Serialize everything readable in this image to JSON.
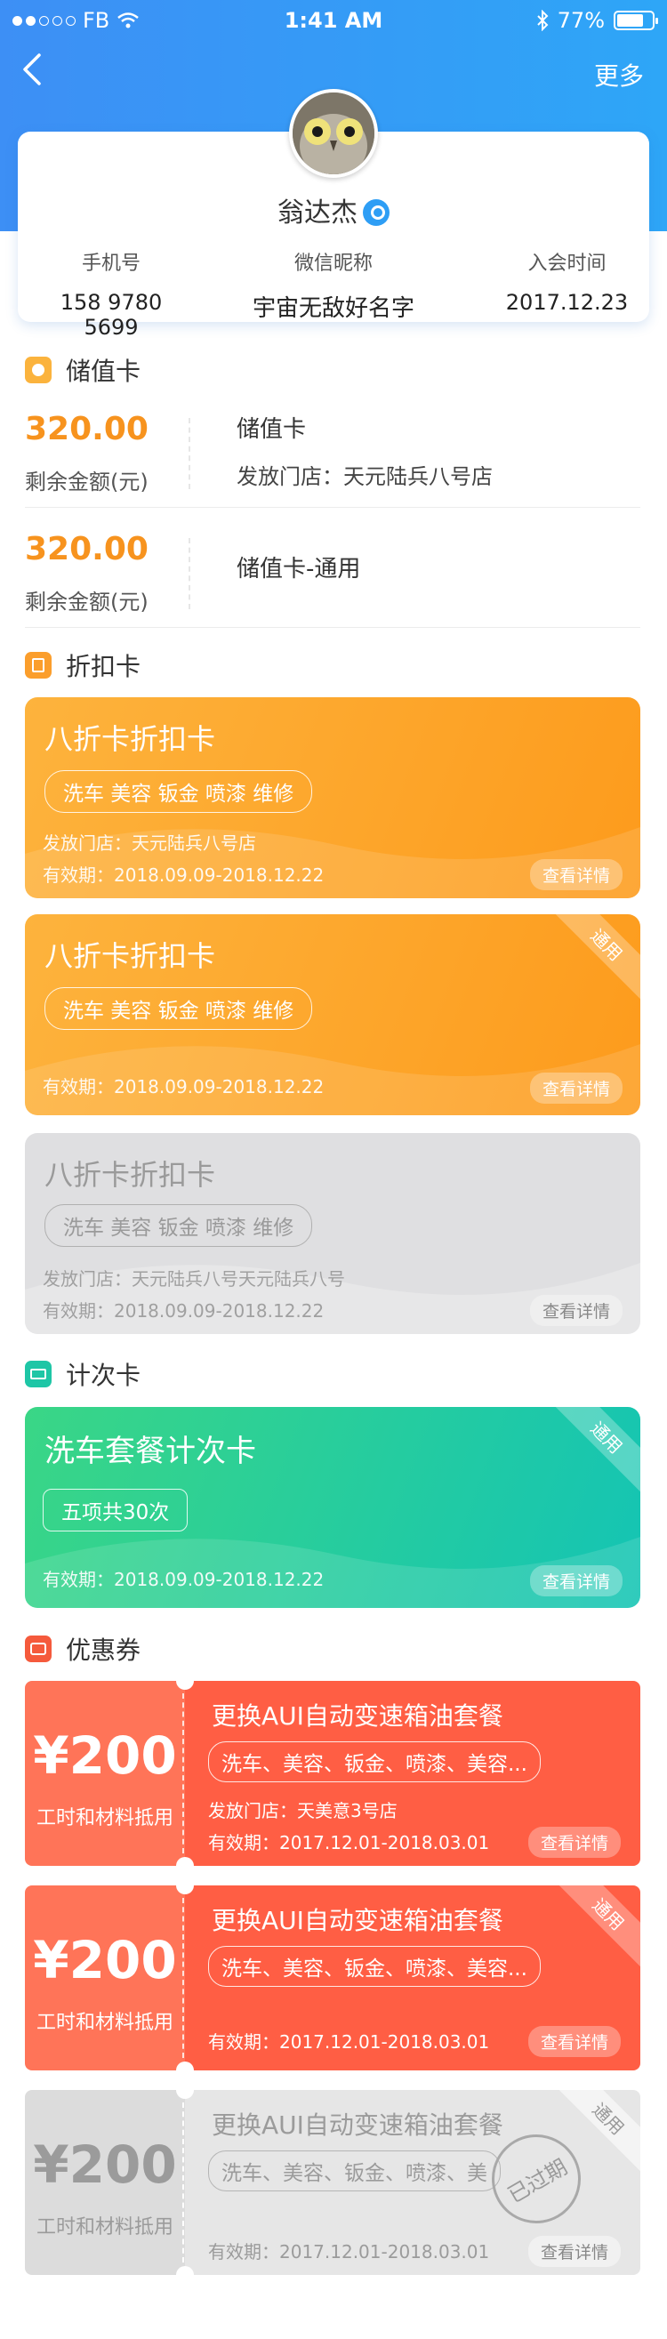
{
  "status_bar": {
    "carrier": "FB",
    "time": "1:41 AM",
    "battery": "77%",
    "battery_level": 0.77
  },
  "nav": {
    "more": "更多"
  },
  "profile": {
    "name": "翁达杰",
    "phone_label": "手机号",
    "phone": "158 9780 5699",
    "wechat_label": "微信昵称",
    "wechat": "宇宙无敌好名字",
    "join_label": "入会时间",
    "join": "2017.12.23"
  },
  "stored_value": {
    "title": "储值卡",
    "items": [
      {
        "amount": "320.00",
        "amount_label": "剩余金额(元)",
        "name": "储值卡",
        "store": "发放门店：天元陆兵八号店"
      },
      {
        "amount": "320.00",
        "amount_label": "剩余金额(元)",
        "name": "储值卡-通用",
        "store": ""
      }
    ]
  },
  "discount": {
    "title": "折扣卡",
    "cards": [
      {
        "title": "八折卡折扣卡",
        "tags": "洗车 美容 钣金 喷漆 维修",
        "store": "发放门店：天元陆兵八号店",
        "validity": "有效期：2018.09.09-2018.12.22",
        "detail": "查看详情",
        "ribbon": ""
      },
      {
        "title": "八折卡折扣卡",
        "tags": "洗车 美容 钣金 喷漆 维修",
        "store": "",
        "validity": "有效期：2018.09.09-2018.12.22",
        "detail": "查看详情",
        "ribbon": "通用"
      },
      {
        "title": "八折卡折扣卡",
        "tags": "洗车 美容 钣金 喷漆 维修",
        "store": "发放门店：天元陆兵八号天元陆兵八号",
        "validity": "有效期：2018.09.09-2018.12.22",
        "detail": "查看详情",
        "ribbon": ""
      }
    ]
  },
  "count": {
    "title": "计次卡",
    "card": {
      "title": "洗车套餐计次卡",
      "tags": "五项共30次",
      "validity": "有效期：2018.09.09-2018.12.22",
      "detail": "查看详情",
      "ribbon": "通用"
    }
  },
  "coupon": {
    "title": "优惠券",
    "items": [
      {
        "amount": "¥200",
        "amount_label": "工时和材料抵用",
        "title": "更换AUI自动变速箱油套餐",
        "tags": "洗车、美容、钣金、喷漆、美容...",
        "store": "发放门店：天美意3号店",
        "validity": "有效期：2017.12.01-2018.03.01",
        "detail": "查看详情",
        "ribbon": ""
      },
      {
        "amount": "¥200",
        "amount_label": "工时和材料抵用",
        "title": "更换AUI自动变速箱油套餐",
        "tags": "洗车、美容、钣金、喷漆、美容...",
        "store": "",
        "validity": "有效期：2017.12.01-2018.03.01",
        "detail": "查看详情",
        "ribbon": "通用"
      },
      {
        "amount": "¥200",
        "amount_label": "工时和材料抵用",
        "title": "更换AUI自动变速箱油套餐",
        "tags": "洗车、美容、钣金、喷漆、美",
        "store": "",
        "validity": "有效期：2017.12.01-2018.03.01",
        "detail": "查看详情",
        "ribbon": "通用",
        "stamp": "已过期"
      }
    ]
  }
}
